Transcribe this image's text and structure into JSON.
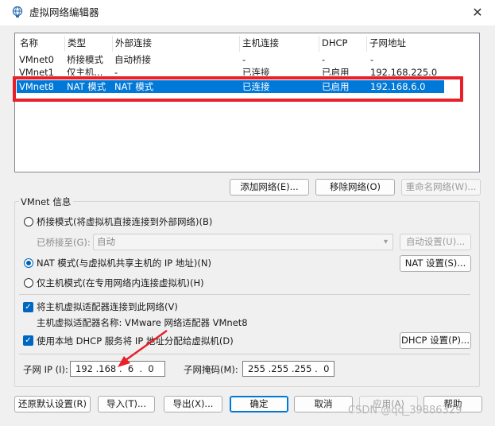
{
  "window": {
    "title": "虚拟网络编辑器",
    "close": "✕"
  },
  "table": {
    "headers": [
      "名称",
      "类型",
      "外部连接",
      "主机连接",
      "DHCP",
      "子网地址"
    ],
    "rows": [
      [
        "VMnet0",
        "桥接模式",
        "自动桥接",
        "-",
        "-",
        "-"
      ],
      [
        "VMnet1",
        "仅主机...",
        "-",
        "已连接",
        "已启用",
        "192.168.225.0"
      ],
      [
        "VMnet8",
        "NAT 模式",
        "NAT 模式",
        "已连接",
        "已启用",
        "192.168.6.0"
      ]
    ],
    "selected_index": 2
  },
  "net_buttons": {
    "add": "添加网络(E)...",
    "remove": "移除网络(O)",
    "rename": "重命名网络(W)..."
  },
  "vmnet_info": {
    "group_label": "VMnet 信息",
    "bridged_label": "桥接模式(将虚拟机直接连接到外部网络)(B)",
    "bridged_to_label": "已桥接至(G):",
    "bridged_to_value": "自动",
    "auto_settings": "自动设置(U)...",
    "nat_label": "NAT 模式(与虚拟机共享主机的 IP 地址)(N)",
    "nat_settings": "NAT 设置(S)...",
    "hostonly_label": "仅主机模式(在专用网络内连接虚拟机)(H)",
    "selected_mode": "nat",
    "connect_adapter_label": "将主机虚拟适配器连接到此网络(V)",
    "adapter_name_label": "主机虚拟适配器名称: VMware 网络适配器 VMnet8",
    "dhcp_label": "使用本地 DHCP 服务将 IP 地址分配给虚拟机(D)",
    "dhcp_settings": "DHCP 设置(P)...",
    "subnet_ip_label": "子网 IP (I):",
    "subnet_ip": "192 .168 .  6  .  0",
    "subnet_mask_label": "子网掩码(M):",
    "subnet_mask": "255 .255 .255 .  0"
  },
  "bottom_buttons": {
    "restore": "还原默认设置(R)",
    "import": "导入(T)...",
    "export": "导出(X)...",
    "ok": "确定",
    "cancel": "取消",
    "apply": "应用(A)",
    "help": "帮助"
  },
  "watermark": "CSDN @qq_39886329",
  "colors": {
    "selection": "#0078d7",
    "annotation_red": "#e8202a",
    "checkbox": "#0067c0"
  }
}
